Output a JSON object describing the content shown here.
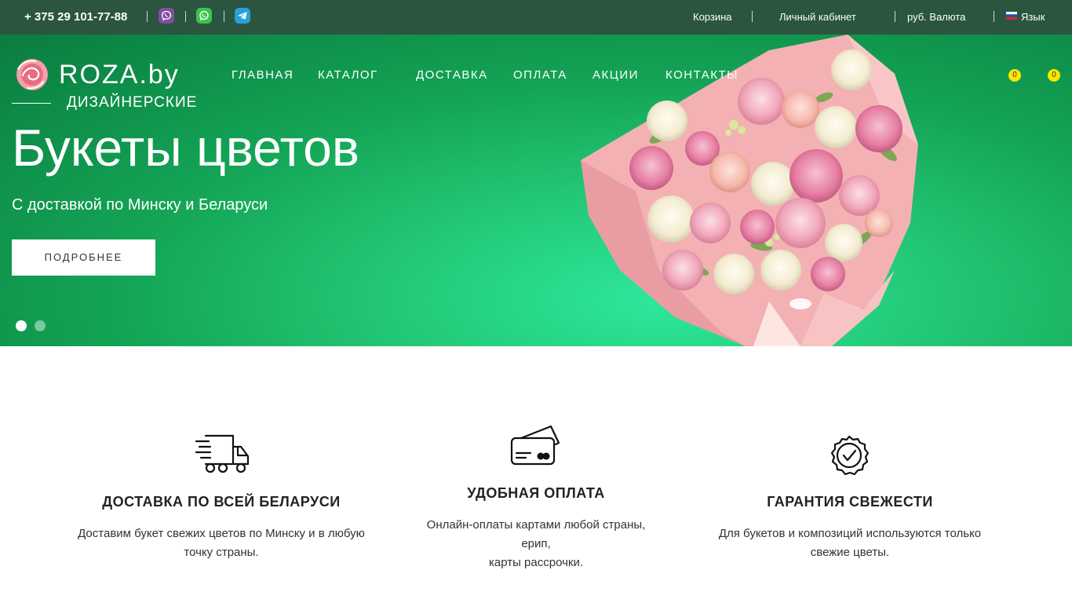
{
  "topbar": {
    "phone": "+ 375 29 101-77-88",
    "messengers": [
      {
        "name": "viber-icon",
        "color": "#7d519b"
      },
      {
        "name": "whatsapp-icon",
        "color": "#3cc24d"
      },
      {
        "name": "telegram-icon",
        "color": "#2a9fd8"
      }
    ],
    "cart": "Корзина",
    "account": "Личный кабинет",
    "currency": "руб. Валюта",
    "language": "Язык"
  },
  "logo": {
    "name": "ROZA.by",
    "tagline": "ДИЗАЙНЕРСКИЕ"
  },
  "nav": {
    "items": [
      "ГЛАВНАЯ",
      "КАТАЛОГ",
      "ДОСТАВКА",
      "ОПЛАТА",
      "АКЦИИ",
      "КОНТАКТЫ"
    ],
    "wishlist_count": "0",
    "cart_count": "0"
  },
  "hero": {
    "title": "Букеты цветов",
    "subtitle": "С доставкой по Минску и Беларуси",
    "button": "ПОДРОБНЕЕ",
    "slides": 2,
    "active_slide": 1
  },
  "features": [
    {
      "title": "ДОСТАВКА ПО ВСЕЙ БЕЛАРУСИ",
      "text": "Доставим букет свежих цветов по Минску и в любую точку страны.",
      "icon": "delivery-truck-icon"
    },
    {
      "title": "УДОБНАЯ ОПЛАТА",
      "text_lines": [
        "Онлайн-оплаты картами любой страны,",
        "ерип,",
        "карты рассрочки."
      ],
      "icon": "credit-card-icon"
    },
    {
      "title": "ГАРАНТИЯ СВЕЖЕСТИ",
      "text": "Для букетов и композиций используются только свежие цветы.",
      "icon": "quality-check-icon"
    }
  ],
  "colors": {
    "topbar_bg": "#2c5540",
    "hero_green": "#14a456",
    "badge": "#ffe600",
    "paper_pink": "#f3b1b4"
  }
}
